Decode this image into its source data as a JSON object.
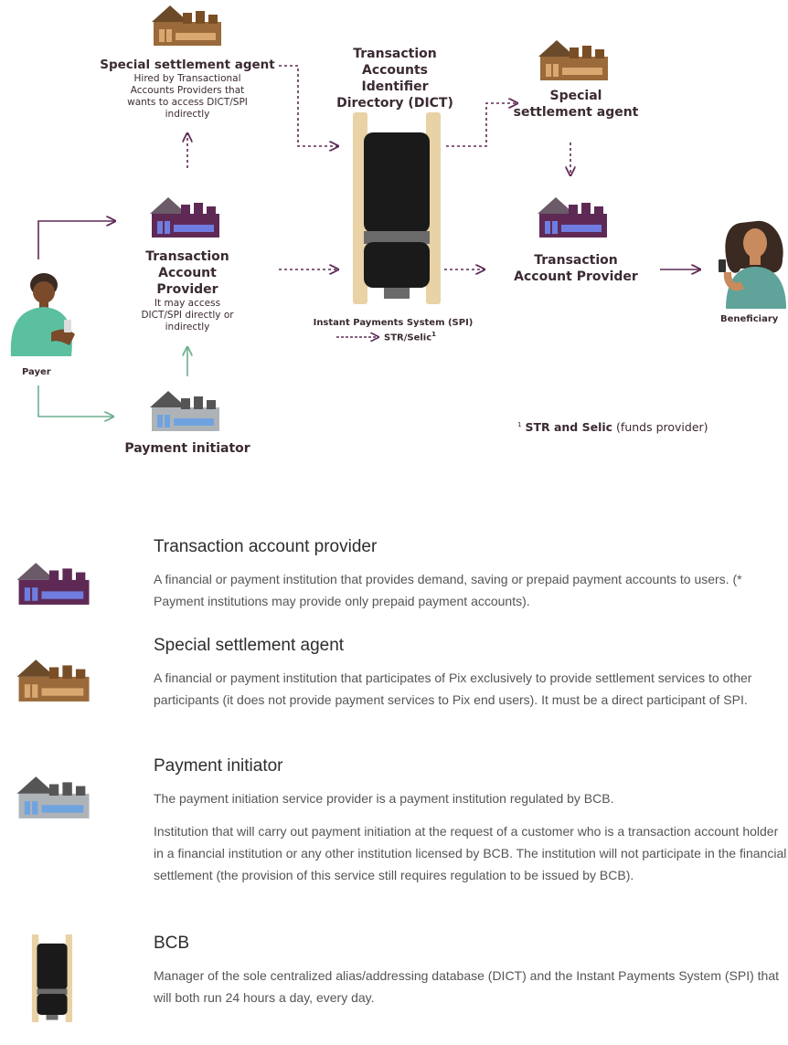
{
  "diagram": {
    "special_agent_left": {
      "title": "Special settlement agent",
      "sub": "Hired by Transactional Accounts Providers that wants to access DICT/SPI indirectly"
    },
    "dict": {
      "title": "Transaction Accounts Identifier Directory (DICT)"
    },
    "special_agent_right": {
      "title": "Special settlement agent"
    },
    "provider_left": {
      "title": "Transaction Account Provider",
      "sub": "It may access DICT/SPI directly or indirectly"
    },
    "provider_right": {
      "title": "Transaction Account Provider"
    },
    "payment_initiator": {
      "title": "Payment initiator"
    },
    "payer": {
      "label": "Payer"
    },
    "beneficiary": {
      "label": "Beneficiary"
    },
    "spi": {
      "title": "Instant Payments System (SPI)",
      "str_label": "STR/Selic",
      "str_sup": "1"
    },
    "footnote": {
      "sup": "1",
      "bold": "STR and Selic",
      "rest": "(funds provider)"
    }
  },
  "legend": [
    {
      "title": "Transaction account provider",
      "desc": [
        "A financial or payment institution that provides demand, saving or prepaid payment accounts to users. (* Payment institutions may provide only prepaid payment accounts)."
      ]
    },
    {
      "title": "Special settlement agent",
      "desc": [
        "A financial or payment institution that participates of Pix exclusively to provide settlement services to other participants (it does not provide payment services to Pix end users). It must be a direct participant of SPI."
      ]
    },
    {
      "title": "Payment initiator",
      "desc": [
        "The payment initiation service provider is a payment institution regulated by BCB.",
        "Institution that will carry out payment initiation at the request of a customer who is a transaction account holder in a financial institution or any other institution licensed by BCB. The institution will not participate in the financial settlement (the provision of this service still requires regulation to be issued by BCB)."
      ]
    },
    {
      "title": "BCB",
      "desc": [
        "Manager of the sole centralized alias/addressing database (DICT) and the Instant Payments System (SPI) that will both run 24 hours a day, every day."
      ]
    }
  ],
  "colors": {
    "purple": "#5e2a55",
    "brown": "#8a5a2b",
    "gray": "#9aa0a6",
    "teal_arrow": "#6daf8f",
    "beige": "#e8d2a6",
    "dark": "#1a1a1a"
  }
}
